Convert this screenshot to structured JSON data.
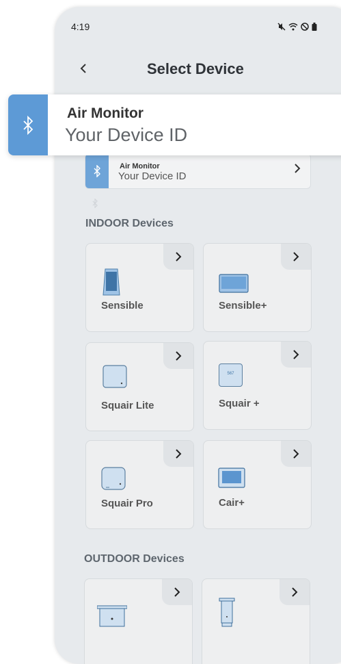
{
  "status_bar": {
    "time": "4:19"
  },
  "header": {
    "title": "Select Device"
  },
  "highlight": {
    "name": "Air Monitor",
    "device_id": "Your Device ID"
  },
  "device_row": {
    "name": "Air Monitor",
    "device_id": "Your Device ID"
  },
  "sections": {
    "indoor": "INDOOR Devices",
    "outdoor": "OUTDOOR Devices"
  },
  "indoor_devices": [
    {
      "label": "Sensible"
    },
    {
      "label": "Sensible+"
    },
    {
      "label": "Squair Lite"
    },
    {
      "label": "Squair +",
      "screen_text": "567"
    },
    {
      "label": "Squair Pro"
    },
    {
      "label": "Cair+"
    }
  ],
  "colors": {
    "accent": "#5d9ad6",
    "background": "#e7eaed",
    "card": "#eeeff0"
  }
}
